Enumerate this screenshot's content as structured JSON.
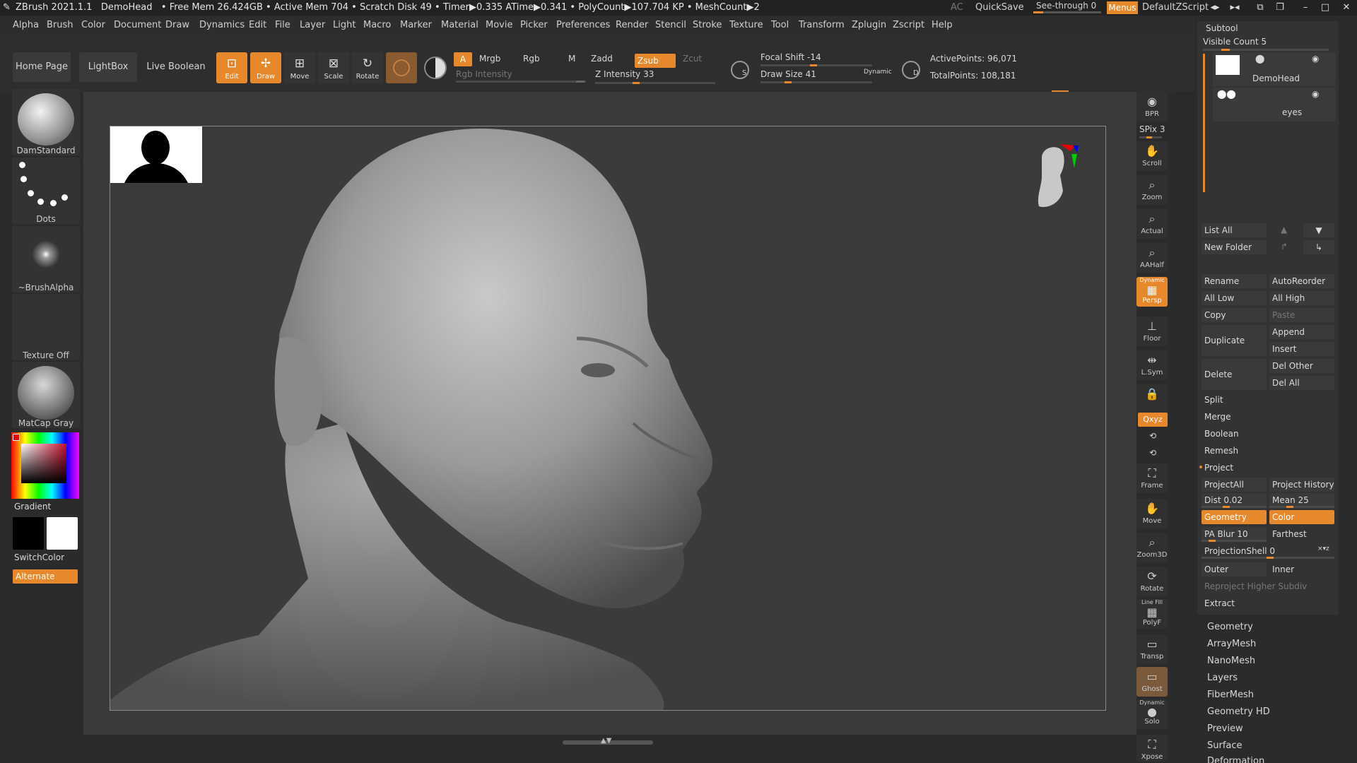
{
  "title_bar": {
    "app": "ZBrush 2021.1.1",
    "doc": "DemoHead",
    "free_mem": "• Free Mem 26.424GB",
    "active_mem": "• Active Mem 704",
    "scratch": "• Scratch Disk 49",
    "timer": "• Timer▶0.335 ATime▶0.341",
    "polycount": "• PolyCount▶107.704 KP",
    "meshcount": "• MeshCount▶2",
    "ac": "AC",
    "quicksave": "QuickSave",
    "see_through": "See-through  0",
    "menus": "Menus",
    "default_script": "DefaultZScript"
  },
  "menu": [
    "Alpha",
    "Brush",
    "Color",
    "Document",
    "Draw",
    "Dynamics",
    "Edit",
    "File",
    "Layer",
    "Light",
    "Macro",
    "Marker",
    "Material",
    "Movie",
    "Picker",
    "Preferences",
    "Render",
    "Stencil",
    "Stroke",
    "Texture",
    "Tool",
    "Transform",
    "Zplugin",
    "Zscript",
    "Help"
  ],
  "toolbar": {
    "home_page": "Home Page",
    "lightbox": "LightBox",
    "live_boolean": "Live Boolean",
    "edit": "Edit",
    "draw": "Draw",
    "move": "Move",
    "scale": "Scale",
    "rotate": "Rotate",
    "a": "A",
    "mrgb": "Mrgb",
    "rgb": "Rgb",
    "m": "M",
    "rgb_intensity": "Rgb Intensity",
    "zadd": "Zadd",
    "zsub": "Zsub",
    "zcut": "Zcut",
    "z_intensity": "Z Intensity 33",
    "focal_shift": "Focal Shift -14",
    "draw_size": "Draw Size 41",
    "dynamic": "Dynamic",
    "s": "S",
    "d": "D",
    "active_points": "ActivePoints: 96,071",
    "total_points": "TotalPoints: 108,181",
    "z_intensity_value": 33,
    "focal_shift_value": -14,
    "draw_size_value": 41
  },
  "left_shelf": {
    "brush": "DamStandard",
    "stroke": "Dots",
    "alpha": "~BrushAlpha",
    "texture": "Texture Off",
    "material": "MatCap Gray",
    "gradient": "Gradient",
    "switch_color": "SwitchColor",
    "alternate": "Alternate"
  },
  "right_tools": {
    "bpr": "BPR",
    "spix": "SPix 3",
    "scroll": "Scroll",
    "zoom": "Zoom",
    "actual": "Actual",
    "aahalf": "AAHalf",
    "dynamic_persp_top": "Dynamic",
    "persp": "Persp",
    "floor": "Floor",
    "lsym": "L.Sym",
    "xyz": "Qxyz",
    "frame": "Frame",
    "move": "Move",
    "zoom3d": "Zoom3D",
    "rotate": "Rotate",
    "line_fill": "Line Fill",
    "polyf": "PolyF",
    "transp": "Transp",
    "ghost": "Ghost",
    "dynamic_solo_top": "Dynamic",
    "solo": "Solo",
    "xpose": "Xpose"
  },
  "subtool": {
    "header": "Subtool",
    "visible_count": "Visible Count 5",
    "items": [
      {
        "name": "DemoHead"
      },
      {
        "name": "eyes"
      }
    ],
    "list_all": "List All",
    "new_folder": "New Folder",
    "rename": "Rename",
    "auto_reorder": "AutoReorder",
    "all_low": "All Low",
    "all_high": "All High",
    "copy": "Copy",
    "paste": "Paste",
    "duplicate": "Duplicate",
    "append": "Append",
    "insert": "Insert",
    "delete": "Delete",
    "del_other": "Del Other",
    "del_all": "Del All",
    "split": "Split",
    "merge": "Merge",
    "boolean": "Boolean",
    "remesh": "Remesh",
    "project": "Project",
    "project_all": "ProjectAll",
    "project_history": "Project History",
    "dist": "Dist 0.02",
    "mean": "Mean 25",
    "geometry": "Geometry",
    "color": "Color",
    "pa_blur": "PA Blur 10",
    "farthest": "Farthest",
    "projection_shell": "ProjectionShell 0",
    "outer": "Outer",
    "inner": "Inner",
    "reproject": "Reproject Higher Subdiv",
    "extract": "Extract"
  },
  "tool_menu": [
    "Geometry",
    "ArrayMesh",
    "NanoMesh",
    "Layers",
    "FiberMesh",
    "Geometry HD",
    "Preview",
    "Surface",
    "Deformation"
  ],
  "colors": {
    "accent": "#e8882c",
    "background": "#2a2a2a",
    "panel": "#333333"
  }
}
